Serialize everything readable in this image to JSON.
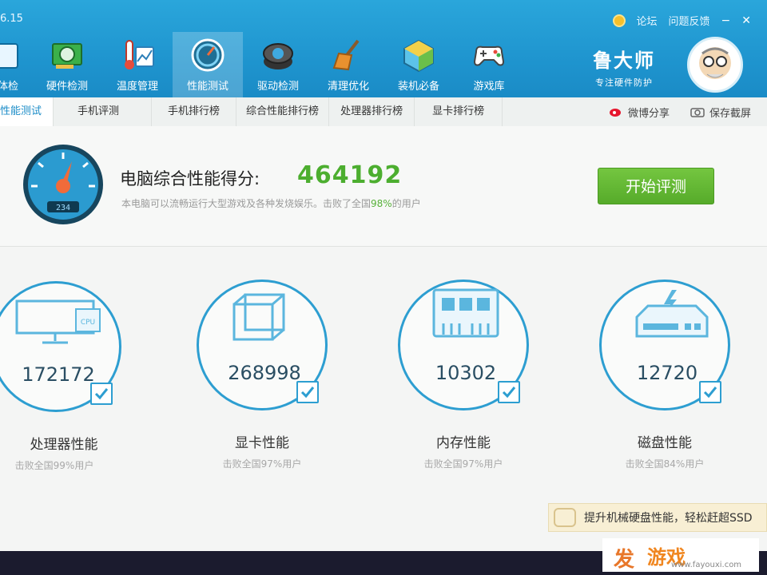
{
  "app": {
    "version": "6.15",
    "top_links": [
      "论坛",
      "问题反馈"
    ],
    "window_buttons": [
      "−",
      "✕"
    ]
  },
  "toolbar": {
    "items": [
      {
        "label": "体检",
        "icon": "monitor-icon",
        "active": false
      },
      {
        "label": "硬件检测",
        "icon": "graphics-card-icon",
        "active": false
      },
      {
        "label": "温度管理",
        "icon": "thermometer-icon",
        "active": false
      },
      {
        "label": "性能测试",
        "icon": "speedometer-icon",
        "active": true
      },
      {
        "label": "驱动检测",
        "icon": "driver-icon",
        "active": false
      },
      {
        "label": "清理优化",
        "icon": "broom-icon",
        "active": false
      },
      {
        "label": "装机必备",
        "icon": "box-icon",
        "active": false
      },
      {
        "label": "游戏库",
        "icon": "gamepad-icon",
        "active": false
      }
    ],
    "brand_name": "鲁大师",
    "brand_sub": "专注硬件防护"
  },
  "subtabs": {
    "items": [
      "性能测试",
      "手机评测",
      "手机排行榜",
      "综合性能排行榜",
      "处理器排行榜",
      "显卡排行榜"
    ],
    "share_label": "微博分享",
    "screenshot_label": "保存截屏"
  },
  "score": {
    "title": "电脑综合性能得分:",
    "value": "464192",
    "desc_prefix": "本电脑可以流畅运行大型游戏及各种发烧娱乐。击败了全国",
    "desc_percent": "98%",
    "desc_suffix": "的用户",
    "gauge_digits": "234",
    "start_button": "开始评测"
  },
  "metrics": [
    {
      "name": "处理器性能",
      "value": "172172",
      "sub": "击败全国99%用户",
      "icon": "cpu-monitor-icon"
    },
    {
      "name": "显卡性能",
      "value": "268998",
      "sub": "击败全国97%用户",
      "icon": "cube-icon"
    },
    {
      "name": "内存性能",
      "value": "10302",
      "sub": "击败全国97%用户",
      "icon": "memory-chip-icon"
    },
    {
      "name": "磁盘性能",
      "value": "12720",
      "sub": "击败全国84%用户",
      "icon": "disk-icon"
    }
  ],
  "promo": {
    "text": "提升机械硬盘性能，轻松赶超SSD"
  },
  "watermark": {
    "text": "游戏",
    "logo": "发",
    "url": "www.fayouxi.com"
  },
  "colors": {
    "accent": "#2d9ed1",
    "score_green": "#4cae2f",
    "button_green": "#5fb533"
  }
}
